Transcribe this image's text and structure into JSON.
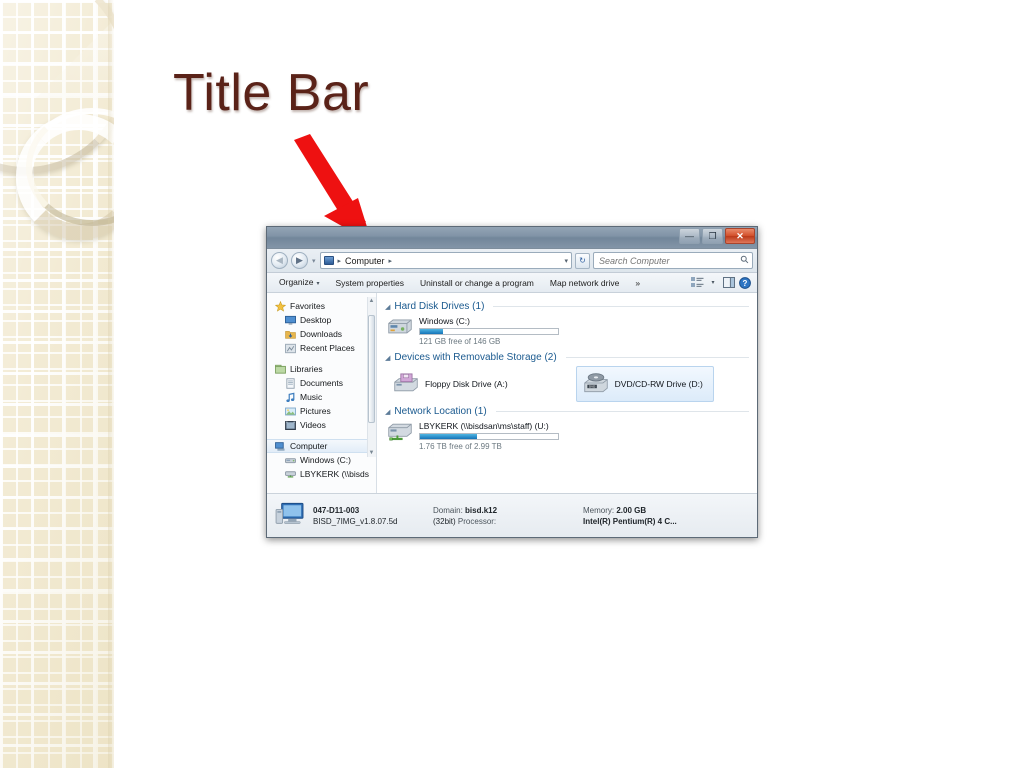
{
  "slide": {
    "title": "Title Bar",
    "title_color": "#5a2218",
    "arrow_color": "#ee1111",
    "theme_band_color": "#f2ead2"
  },
  "explorer": {
    "titlebar": {
      "title": "",
      "minimize_label": "—",
      "maximize_label": "❐",
      "close_label": "✕",
      "minimize_name": "minimize",
      "maximize_name": "maximize",
      "close_name": "close"
    },
    "address": {
      "back_glyph": "◀",
      "forward_glyph": "▶",
      "history_caret": "▾",
      "breadcrumb_icon": "computer-icon",
      "breadcrumb_sep_1": "▸",
      "breadcrumb_text": "Computer",
      "breadcrumb_sep_2": "▸",
      "dropdown_caret": "▾",
      "refresh_glyph": "↻",
      "search_placeholder": "Search Computer",
      "search_value": "",
      "search_icon": "🔍"
    },
    "toolbar": {
      "organize": "Organize",
      "organize_caret": "▾",
      "system_properties": "System properties",
      "uninstall": "Uninstall or change a program",
      "map_network_drive": "Map network drive",
      "overflow": "»",
      "view_caret": "▾"
    },
    "sidebar": {
      "groups": [
        {
          "header": "Favorites",
          "header_icon_color": "#f2c14b",
          "items": [
            {
              "label": "Desktop",
              "icon_color": "#3f7fc1"
            },
            {
              "label": "Downloads",
              "icon_color": "#e0a733"
            },
            {
              "label": "Recent Places",
              "icon_color": "#9aa9b6"
            }
          ]
        },
        {
          "header": "Libraries",
          "header_icon_color": "#8fb96e",
          "items": [
            {
              "label": "Documents",
              "icon_color": "#cfd6dd"
            },
            {
              "label": "Music",
              "icon_color": "#3f7fc1"
            },
            {
              "label": "Pictures",
              "icon_color": "#6fa8d6"
            },
            {
              "label": "Videos",
              "icon_color": "#4a5a6b"
            }
          ]
        },
        {
          "header": "Computer",
          "header_icon_color": "#5b87b5",
          "selected": true,
          "items": [
            {
              "label": "Windows (C:)",
              "icon_color": "#b8bec5"
            },
            {
              "label": "LBYKERK (\\\\bisds",
              "icon_color": "#7fa8c9"
            }
          ]
        }
      ],
      "scroll_up": "▲",
      "scroll_down": "▼"
    },
    "sections": [
      {
        "title": "Hard Disk Drives (1)",
        "triangle": "◢",
        "type": "gauge",
        "items": [
          {
            "name": "Windows (C:)",
            "sub": "121 GB free of 146 GB",
            "fill_percent": 17,
            "icon": "hard-drive-icon"
          }
        ]
      },
      {
        "title": "Devices with Removable Storage (2)",
        "triangle": "◢",
        "type": "tiles",
        "items": [
          {
            "name": "Floppy Disk Drive (A:)",
            "icon": "floppy-drive-icon",
            "selected": false
          },
          {
            "name": "DVD/CD-RW Drive (D:)",
            "icon": "dvd-drive-icon",
            "selected": true
          }
        ]
      },
      {
        "title": "Network Location (1)",
        "triangle": "◢",
        "type": "gauge",
        "items": [
          {
            "name": "LBYKERK (\\\\bisdsan\\ms\\staff) (U:)",
            "sub": "1.76 TB free of 2.99 TB",
            "fill_percent": 41,
            "icon": "network-drive-icon"
          }
        ]
      }
    ],
    "status": {
      "icon": "computer-icon",
      "computer_name": "047-D11-003",
      "domain_label": "Domain:",
      "domain_value": "bisd.k12",
      "memory_label": "Memory:",
      "memory_value": "2.00 GB",
      "image_name": "BISD_7IMG_v1.8.07.5d",
      "bitness": "(32bit)",
      "processor_label": "Processor:",
      "processor_value": "Intel(R) Pentium(R) 4 C..."
    }
  }
}
